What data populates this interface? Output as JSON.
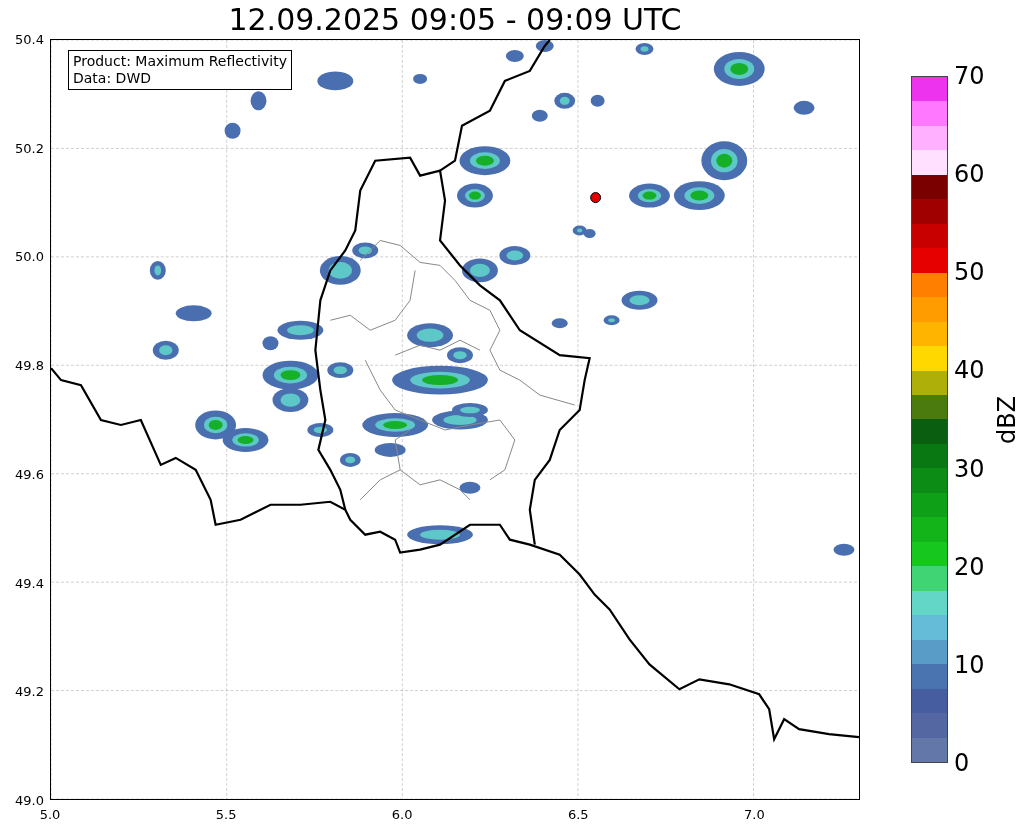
{
  "title": "12.09.2025 09:05 - 09:09 UTC",
  "legend": {
    "lines": [
      "Product: Maximum Reflectivity",
      "Data: DWD"
    ]
  },
  "map": {
    "x_ticks": [
      "5.0",
      "5.5",
      "6.0",
      "6.5",
      "7.0"
    ],
    "y_ticks": [
      "50.4",
      "50.2",
      "50.0",
      "49.8",
      "49.6",
      "49.4",
      "49.2",
      "49.0"
    ]
  },
  "colorbar": {
    "label": "dBZ",
    "ticks": [
      "70",
      "60",
      "50",
      "40",
      "30",
      "20",
      "10",
      "0"
    ],
    "bands": [
      {
        "color": "#6378a8"
      },
      {
        "color": "#5467a3"
      },
      {
        "color": "#465ea0"
      },
      {
        "color": "#4a74b0"
      },
      {
        "color": "#5a9cc8"
      },
      {
        "color": "#64bcd8"
      },
      {
        "color": "#64d6c8"
      },
      {
        "color": "#40d474"
      },
      {
        "color": "#16c81e"
      },
      {
        "color": "#12b41a"
      },
      {
        "color": "#0ea016"
      },
      {
        "color": "#0c8c14"
      },
      {
        "color": "#0a7812"
      },
      {
        "color": "#0a5e10"
      },
      {
        "color": "#4b7a0e"
      },
      {
        "color": "#afaf0a"
      },
      {
        "color": "#ffd800"
      },
      {
        "color": "#ffb400"
      },
      {
        "color": "#ff9c00"
      },
      {
        "color": "#ff7f00"
      },
      {
        "color": "#e60000"
      },
      {
        "color": "#c80000"
      },
      {
        "color": "#a00000"
      },
      {
        "color": "#7a0000"
      },
      {
        "color": "#ffe0ff"
      },
      {
        "color": "#ffb0ff"
      },
      {
        "color": "#ff78ff"
      },
      {
        "color": "#ee33ee"
      }
    ]
  }
}
